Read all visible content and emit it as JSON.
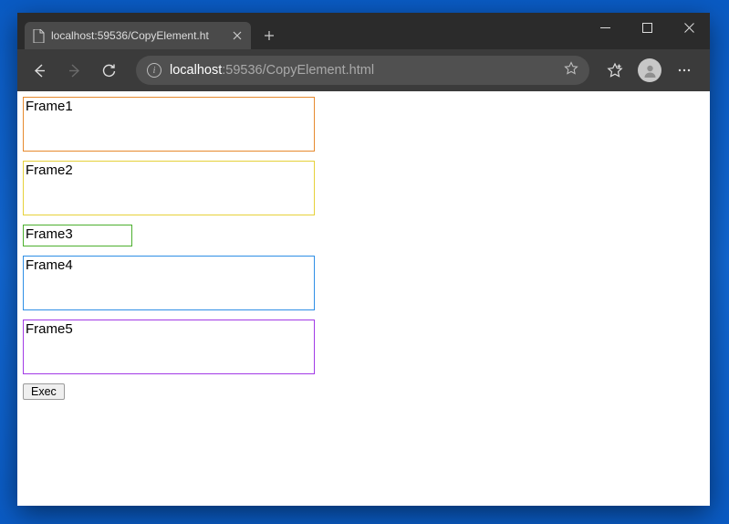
{
  "tab": {
    "title": "localhost:59536/CopyElement.ht"
  },
  "address": {
    "host": "localhost",
    "rest": ":59536/CopyElement.html"
  },
  "frames": [
    {
      "label": "Frame1"
    },
    {
      "label": "Frame2"
    },
    {
      "label": "Frame3"
    },
    {
      "label": "Frame4"
    },
    {
      "label": "Frame5"
    }
  ],
  "exec_label": "Exec"
}
